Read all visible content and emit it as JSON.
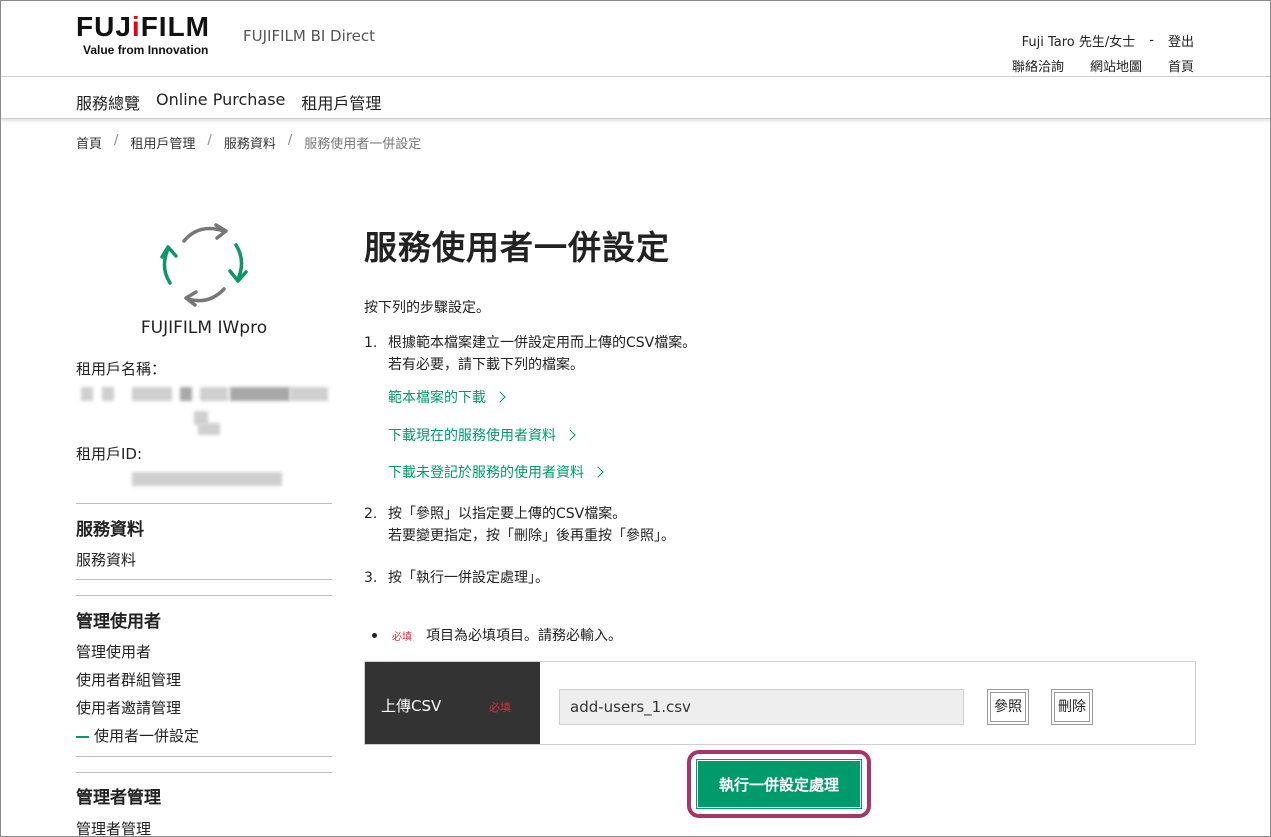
{
  "header": {
    "logo_text_left": "FUJ",
    "logo_text_accent": "i",
    "logo_text_right": "FILM",
    "logo_tagline": "Value from Innovation",
    "site_name": "FUJIFILM BI Direct",
    "user_name": "Fuji Taro 先生/女士",
    "user_sep": "-",
    "logout": "登出",
    "links": [
      "聯絡洽詢",
      "網站地圖",
      "首頁"
    ]
  },
  "nav": {
    "items": [
      "服務總覽",
      "Online Purchase",
      "租用戶管理"
    ]
  },
  "breadcrumb": {
    "items": [
      "首頁",
      "租用戶管理",
      "服務資料"
    ],
    "separator": "/",
    "current": "服務使用者一併設定"
  },
  "sidebar": {
    "app_name": "FUJIFILM IWpro",
    "tenant_name_label": "租用戶名稱：",
    "tenant_id_label": "租用戶ID:",
    "sections": [
      {
        "heading": "服務資料",
        "items": [
          "服務資料"
        ]
      },
      {
        "heading": "管理使用者",
        "items": [
          "管理使用者",
          "使用者群組管理",
          "使用者邀請管理",
          "使用者一併設定"
        ]
      },
      {
        "heading": "管理者管理",
        "items": [
          "管理者管理"
        ]
      }
    ]
  },
  "main": {
    "title": "服務使用者一併設定",
    "intro": "按下列的步驟設定。",
    "step1_num": "1.",
    "step1_line1": "根據範本檔案建立一併設定用而上傳的CSV檔案。",
    "step1_line2": "若有必要，請下載下列的檔案。",
    "links": [
      "範本檔案的下載",
      "下載現在的服務使用者資料",
      "下載未登記於服務的使用者資料"
    ],
    "step2_num": "2.",
    "step2_line1": "按「參照」以指定要上傳的CSV檔案。",
    "step2_line2": "若要變更指定，按「刪除」後再重按「參照」。",
    "step3_num": "3.",
    "step3_line1": "按「執行一併設定處理」。",
    "required_badge": "必填",
    "required_note": "項目為必填項目。請務必輸入。",
    "upload_label": "上傳CSV",
    "upload_required": "必填",
    "file_value": "add-users_1.csv",
    "browse_button": "參照",
    "delete_button": "刪除",
    "execute_button": "執行一併設定處理"
  },
  "colors": {
    "accent_green": "#009a6b",
    "required_red": "#e02b3c",
    "highlight_border": "#a8356a",
    "label_bg": "#333333"
  }
}
